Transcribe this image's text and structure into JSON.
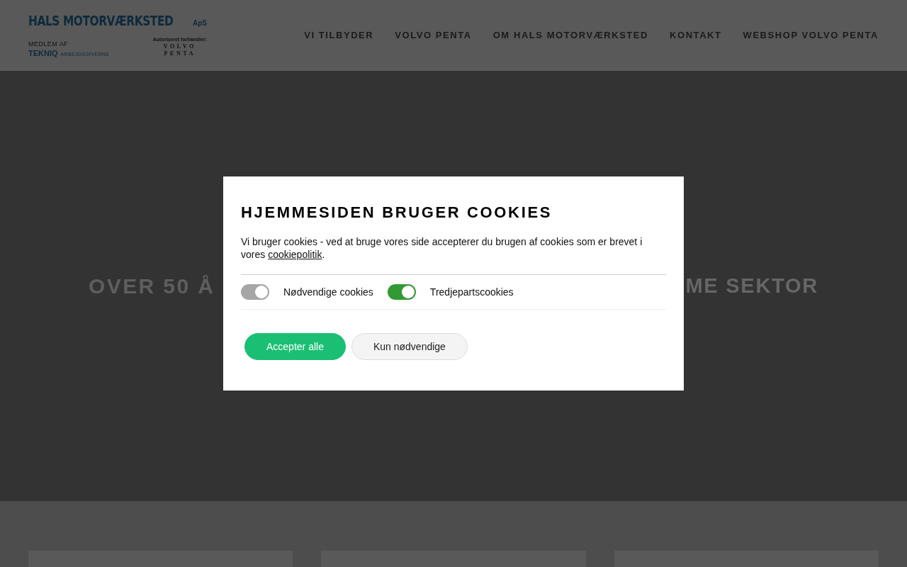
{
  "logo": {
    "name": "HALS MOTORVÆRKSTED",
    "suffix": "ApS",
    "member_label": "MEDLEM AF",
    "member_org": "TEKNIQ",
    "member_org_sub": "ARBEJDSGIVERNE",
    "dealer_label": "Autoriseret forhandler:",
    "dealer_brand_line1": "VOLVO",
    "dealer_brand_line2": "PENTA"
  },
  "nav": [
    {
      "label": "VI TILBYDER"
    },
    {
      "label": "VOLVO PENTA"
    },
    {
      "label": "OM HALS MOTORVÆRKSTED"
    },
    {
      "label": "KONTAKT"
    },
    {
      "label": "WEBSHOP VOLVO PENTA"
    }
  ],
  "hero": {
    "text_left": "OVER 50 Å",
    "text_right": "ME SEKTOR"
  },
  "cookie_dialog": {
    "title": "HJEMMESIDEN BRUGER COOKIES",
    "text_before": "Vi bruger cookies - ved at bruge vores side accepterer du brugen af cookies som er brevet i vores ",
    "link": "cookiepolitik",
    "text_after": ".",
    "toggles": [
      {
        "label": "Nødvendige cookies",
        "on": true,
        "disabled": true
      },
      {
        "label": "Tredjepartscookies",
        "on": true,
        "disabled": false
      }
    ],
    "buttons": [
      {
        "label": "Accepter alle",
        "kind": "primary"
      },
      {
        "label": "Kun nødvendige",
        "kind": "secondary"
      }
    ]
  }
}
